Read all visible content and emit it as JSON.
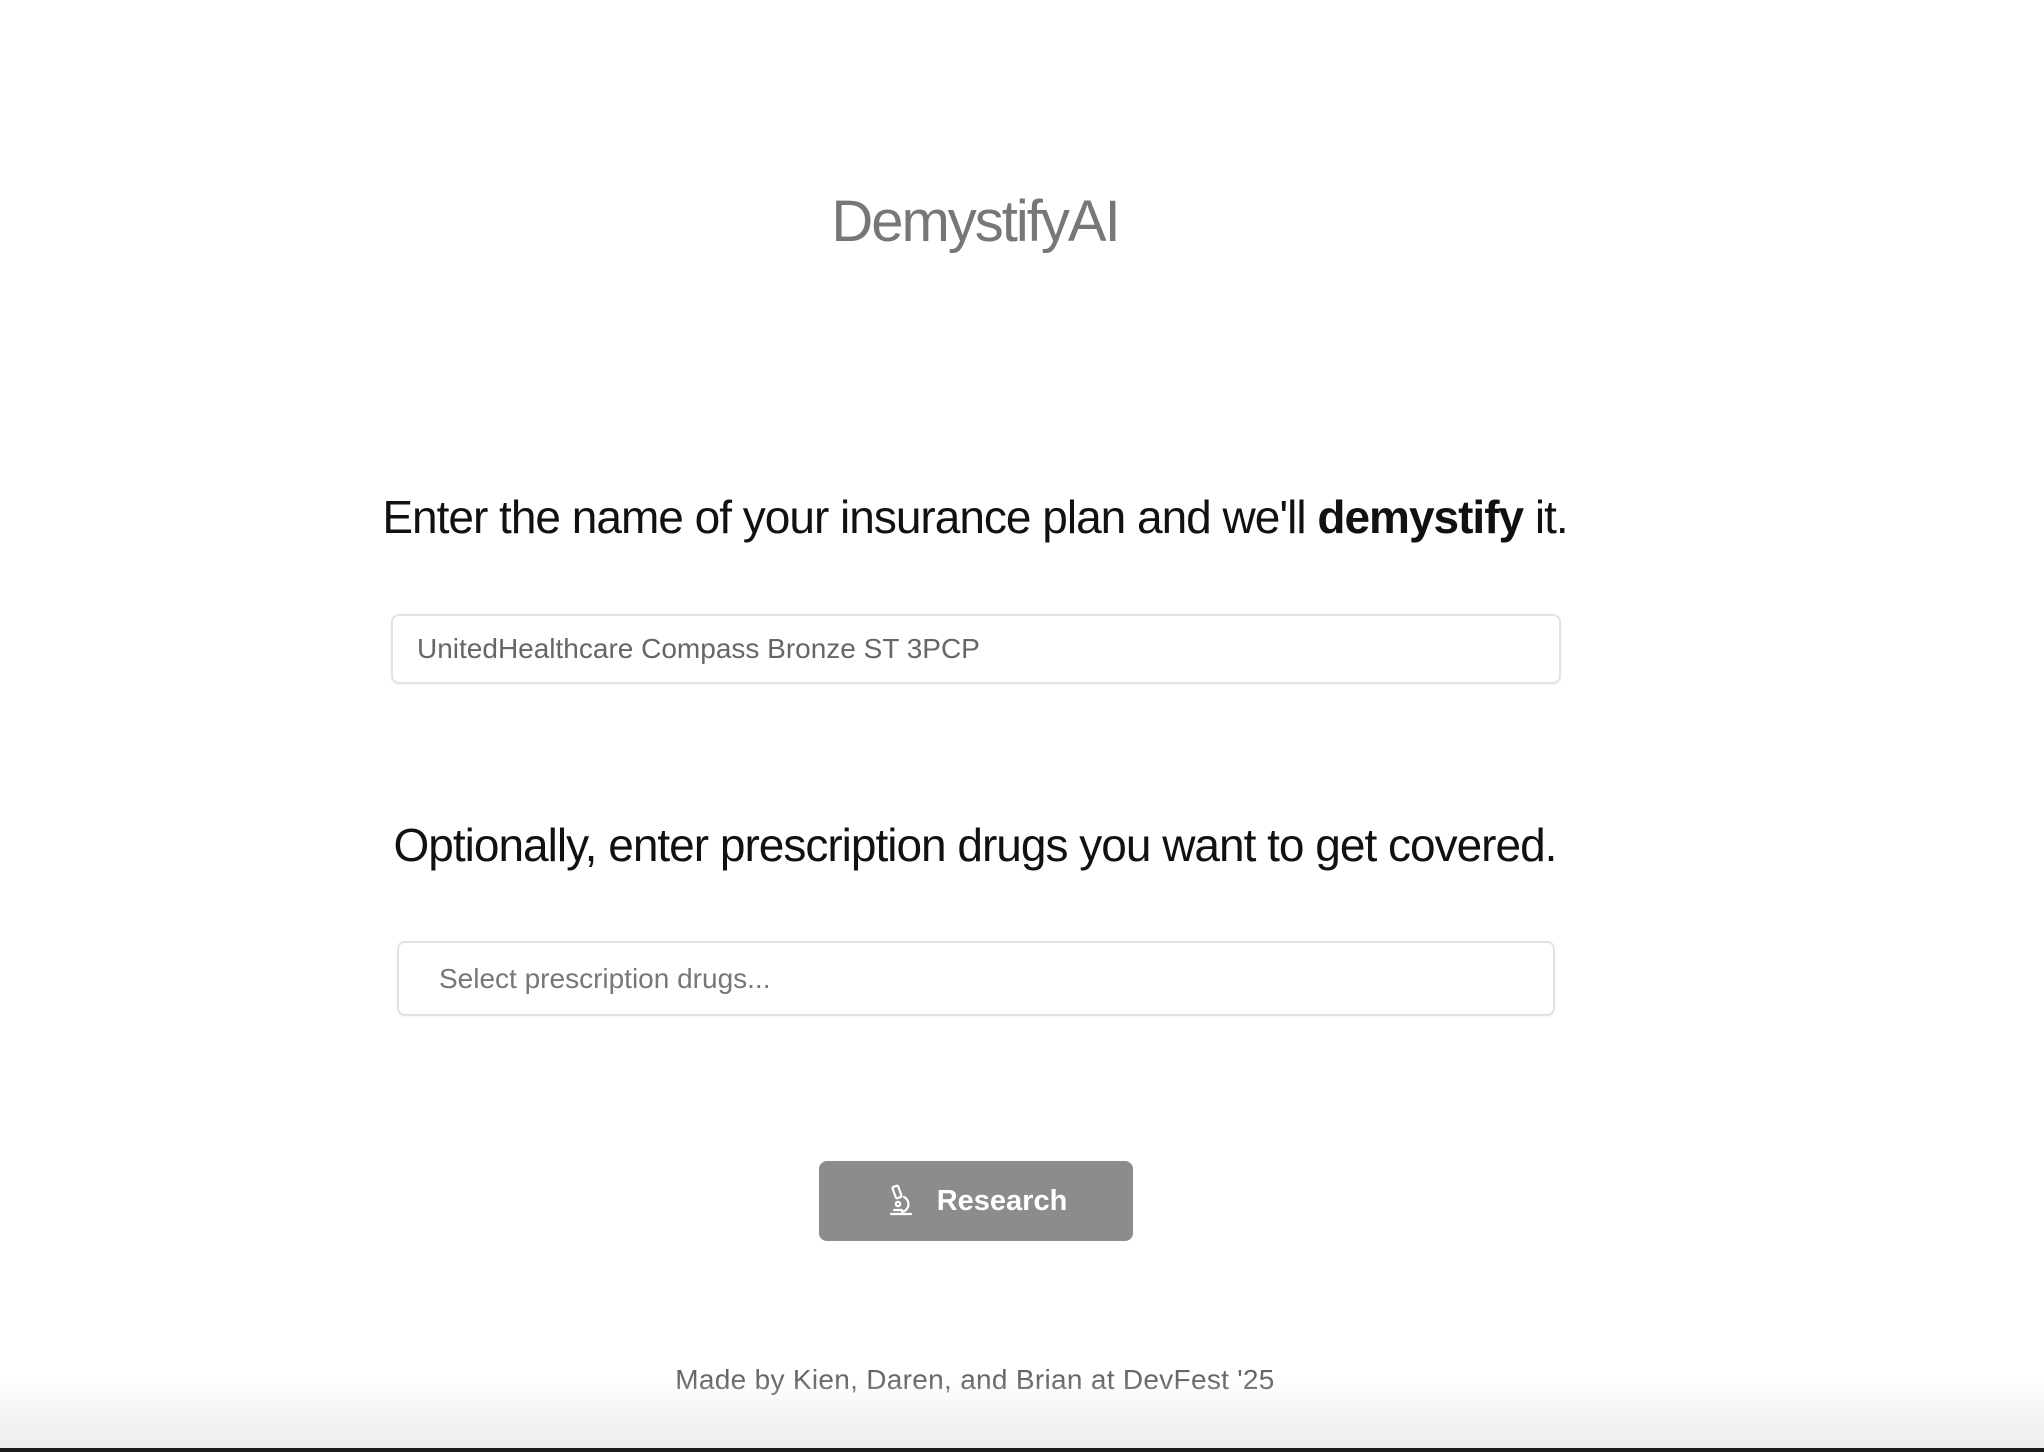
{
  "app": {
    "logo": "DemystifyAI"
  },
  "plan_section": {
    "heading_prefix": "Enter the name of your insurance plan and we'll ",
    "heading_emphasis": "demystify",
    "heading_suffix": " it.",
    "input_value": "UnitedHealthcare Compass Bronze ST 3PCP"
  },
  "drugs_section": {
    "heading": "Optionally, enter prescription drugs you want to get covered.",
    "placeholder": "Select prescription drugs..."
  },
  "actions": {
    "research_label": "Research",
    "research_icon": "microscope-icon",
    "button_color": "#8c8c8c"
  },
  "footer": {
    "credit": "Made by Kien, Daren, and Brian at DevFest '25"
  }
}
